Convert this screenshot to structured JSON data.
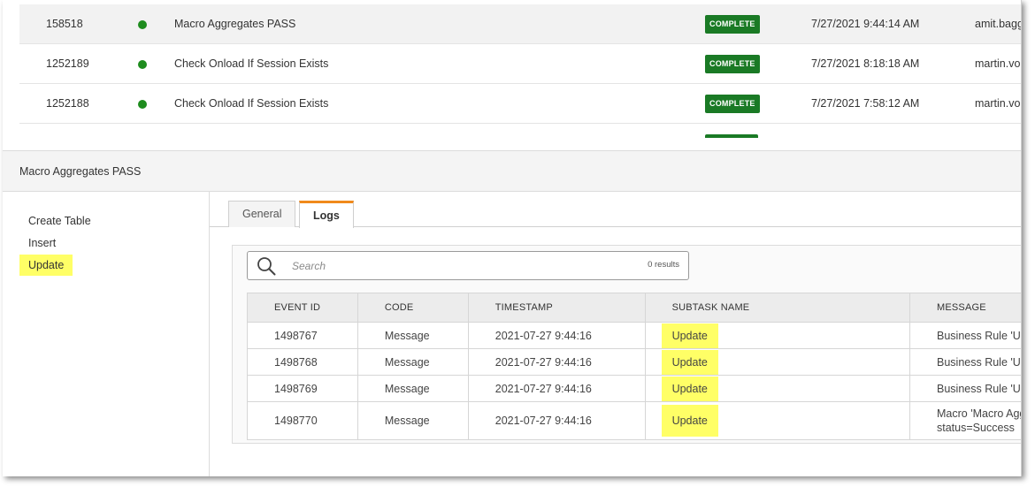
{
  "jobs": [
    {
      "id": "158518",
      "name": "Macro Aggregates PASS",
      "status": "COMPLETE",
      "time": "7/27/2021 9:44:14 AM",
      "user": "amit.bagg"
    },
    {
      "id": "1252189",
      "name": "Check Onload If Session Exists",
      "status": "COMPLETE",
      "time": "7/27/2021 8:18:18 AM",
      "user": "martin.vo"
    },
    {
      "id": "1252188",
      "name": "Check Onload If Session Exists",
      "status": "COMPLETE",
      "time": "7/27/2021 7:58:12 AM",
      "user": "martin.vo"
    }
  ],
  "detail": {
    "title": "Macro Aggregates PASS"
  },
  "subtasks": [
    "Create Table",
    "Insert",
    "Update"
  ],
  "tabs": {
    "general": "General",
    "logs": "Logs"
  },
  "search": {
    "placeholder": "Search",
    "results": "0 results"
  },
  "log_table": {
    "headers": [
      "EVENT ID",
      "CODE",
      "TIMESTAMP",
      "SUBTASK NAME",
      "MESSAGE"
    ],
    "rows": [
      {
        "event_id": "1498767",
        "code": "Message",
        "timestamp": "2021-07-27 9:44:16",
        "subtask": "Update",
        "message": "Business Rule 'Up"
      },
      {
        "event_id": "1498768",
        "code": "Message",
        "timestamp": "2021-07-27 9:44:16",
        "subtask": "Update",
        "message": "Business Rule 'Up"
      },
      {
        "event_id": "1498769",
        "code": "Message",
        "timestamp": "2021-07-27 9:44:16",
        "subtask": "Update",
        "message": "Business Rule 'Up"
      },
      {
        "event_id": "1498770",
        "code": "Message",
        "timestamp": "2021-07-27 9:44:16",
        "subtask": "Update",
        "message": "Macro 'Macro Agg",
        "message_line2": "status=Success"
      }
    ]
  },
  "colors": {
    "status_green": "#1a7a25",
    "dot_green": "#1e8c1e",
    "highlight": "#ffff66",
    "tab_accent": "#f08a1c"
  }
}
